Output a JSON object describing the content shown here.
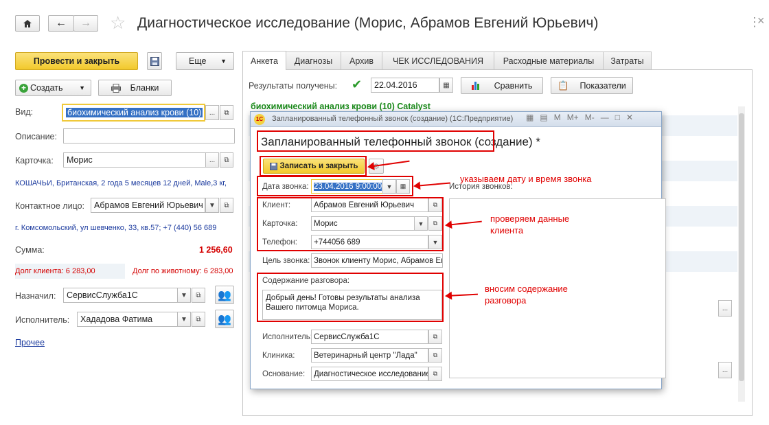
{
  "window": {
    "title": "Диагностическое исследование (Морис, Абрамов Евгений Юрьевич)"
  },
  "toolbar": {
    "post_close": "Провести и закрыть",
    "more": "Еще",
    "create": "Создать",
    "forms": "Бланки"
  },
  "left": {
    "vid_label": "Вид:",
    "vid_value": "биохимический анализ крови (10)",
    "desc_label": "Описание:",
    "card_label": "Карточка:",
    "card_value": "Морис",
    "pet_info": "КОШАЧЬИ, Британская, 2 года 5 месяцев 12 дней, Male,3 кг,",
    "contact_label": "Контактное лицо:",
    "contact_value": "Абрамов Евгений Юрьевич",
    "address": "г. Комсомольский, ул шевченко, 33, кв.57; +7  (440)  56 689",
    "sum_label": "Сумма:",
    "sum_value": "1 256,60",
    "debt_client": "Долг клиента: 6 283,00",
    "debt_animal": "Долг по животному: 6 283,00",
    "assigned_label": "Назначил:",
    "assigned_value": "СервисСлужба1С",
    "executor_label": "Исполнитель:",
    "executor_value": "Хададова Фатима",
    "other_link": "Прочее"
  },
  "tabs": [
    "Анкета",
    "Диагнозы",
    "Архив",
    "ЧЕК ИССЛЕДОВАНИЯ",
    "Расходные материалы",
    "Затраты"
  ],
  "anketa": {
    "results_label": "Результаты получены:",
    "results_date": "22.04.2016",
    "compare": "Сравнить",
    "indicators": "Показатели",
    "section_title": "биохимический анализ крови (10) Catalyst"
  },
  "modal": {
    "window_title": "Запланированный телефонный звонок (создание) (1С:Предприятие)",
    "heading": "Запланированный телефонный звонок (создание) *",
    "save_close": "Записать и закрыть",
    "date_label": "Дата звонка:",
    "date_value": "23.04.2016  9:00:00",
    "history_label": "История звонков:",
    "client_label": "Клиент:",
    "client_value": "Абрамов Евгений Юрьевич",
    "card_label": "Карточка:",
    "card_value": "Морис",
    "phone_label": "Телефон:",
    "phone_value": "+744056 689",
    "goal_label": "Цель звонка:",
    "goal_value": "Звонок клиенту Морис, Абрамов Евг",
    "content_label": "Содержание  разговора:",
    "content_value": "Добрый день! Готовы результаты анализа Вашего питомца Мориса.",
    "executor_label": "Исполнитель:",
    "executor_value": "СервисСлужба1С",
    "clinic_label": "Клиника:",
    "clinic_value": "Ветеринарный центр \"Лада\"",
    "basis_label": "Основание:",
    "basis_value": "Диагностическое исследование"
  },
  "annotations": {
    "date_note": "указываем дату и время звонка",
    "client_note": "проверяем данные клиента",
    "content_note": "вносим содержание разговора"
  },
  "colors": {
    "accent_yellow": "#f7d33c",
    "section_green": "#1a8a1a",
    "annotation_red": "#e00000",
    "sum_red": "#d40000"
  }
}
